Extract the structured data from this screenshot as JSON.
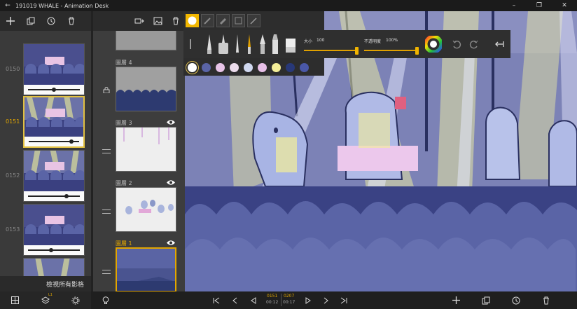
{
  "window": {
    "title": "191019 WHALE - Animation Desk",
    "back_glyph": "←",
    "minimize_glyph": "–",
    "maximize_glyph": "❐",
    "close_glyph": "✕"
  },
  "frames": {
    "items": [
      {
        "number": "0150"
      },
      {
        "number": "0151"
      },
      {
        "number": "0152"
      },
      {
        "number": "0153"
      },
      {
        "number": ""
      }
    ],
    "current": "0151",
    "view_all_label": "檢視所有影格"
  },
  "layers": {
    "items": [
      {
        "name": "圖層 4",
        "eye": false,
        "locked": true
      },
      {
        "name": "圖層 3",
        "eye": true,
        "locked": false
      },
      {
        "name": "圖層 2",
        "eye": true,
        "locked": false
      },
      {
        "name": "圖層 1",
        "eye": true,
        "locked": false
      }
    ],
    "active": "圖層 1"
  },
  "brush_panel": {
    "size_label": "大小",
    "size_value": "100",
    "size_fraction": 1.0,
    "opacity_label": "不透明度",
    "opacity_value": "100%",
    "opacity_fraction": 1.0
  },
  "palette": {
    "swatches": [
      "#ffffff",
      "#5a64a6",
      "#e8c4e8",
      "#ecdcec",
      "#d0d8f0",
      "#e8c0e8",
      "#f4ee98",
      "#283878",
      "#4a58a8"
    ],
    "selected_index": 0
  },
  "playback": {
    "current_frame": "0151",
    "total_frames": "0207",
    "current_time": "00:12",
    "total_time": "00:17"
  },
  "bottom_left": {
    "layers_badge": "L1"
  },
  "colors": {
    "accent": "#e2a600",
    "canvas_bg": "#7c82b6",
    "stage_bg": "#4a4f8e",
    "crowd": "#5a64a6",
    "spotlight": "#f0f0a0"
  }
}
